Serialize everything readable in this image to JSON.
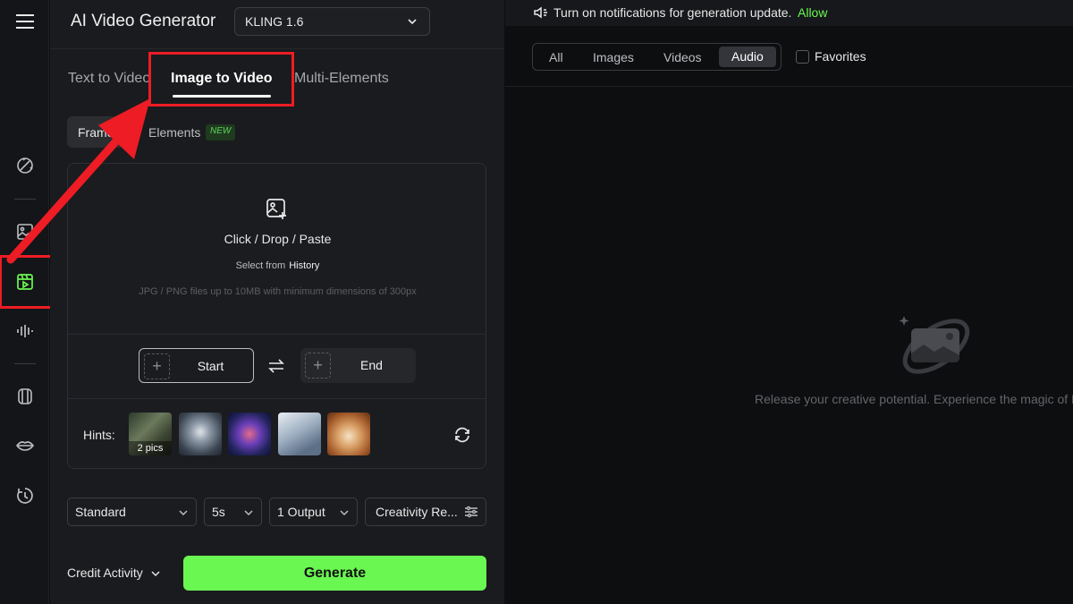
{
  "app": {
    "title": "AI Video Generator",
    "model": "KLING 1.6"
  },
  "mode_tabs": [
    {
      "label": "Text to Video"
    },
    {
      "label": "Image to Video"
    },
    {
      "label": "Multi-Elements"
    }
  ],
  "sub_tabs": {
    "frames": "Frames",
    "elements": "Elements",
    "new_badge": "NEW"
  },
  "upload": {
    "title": "Click / Drop / Paste",
    "select_from": "Select from",
    "history": "History",
    "note": "JPG / PNG files up to 10MB with minimum dimensions of 300px",
    "start": "Start",
    "end": "End"
  },
  "hints": {
    "label": "Hints:",
    "first_count": "2 pics"
  },
  "options": {
    "quality": "Standard",
    "duration": "5s",
    "outputs": "1 Output",
    "creativity": "Creativity Re..."
  },
  "footer": {
    "credit": "Credit Activity",
    "generate": "Generate"
  },
  "notification": {
    "text": "Turn on notifications for generation update.",
    "allow": "Allow"
  },
  "filters": {
    "tabs": [
      "All",
      "Images",
      "Videos",
      "Audio"
    ],
    "active": "Audio",
    "favorites": "Favorites"
  },
  "empty_state": "Release your creative potential. Experience the magic of K",
  "colors": {
    "accent": "#6af751",
    "highlight": "#ee1c24"
  },
  "sidebar_icons": [
    "menu-icon",
    "magic-brush-icon",
    "image-icon",
    "video-icon",
    "audio-wave-icon",
    "avatar-icon",
    "lips-icon",
    "history-icon"
  ]
}
